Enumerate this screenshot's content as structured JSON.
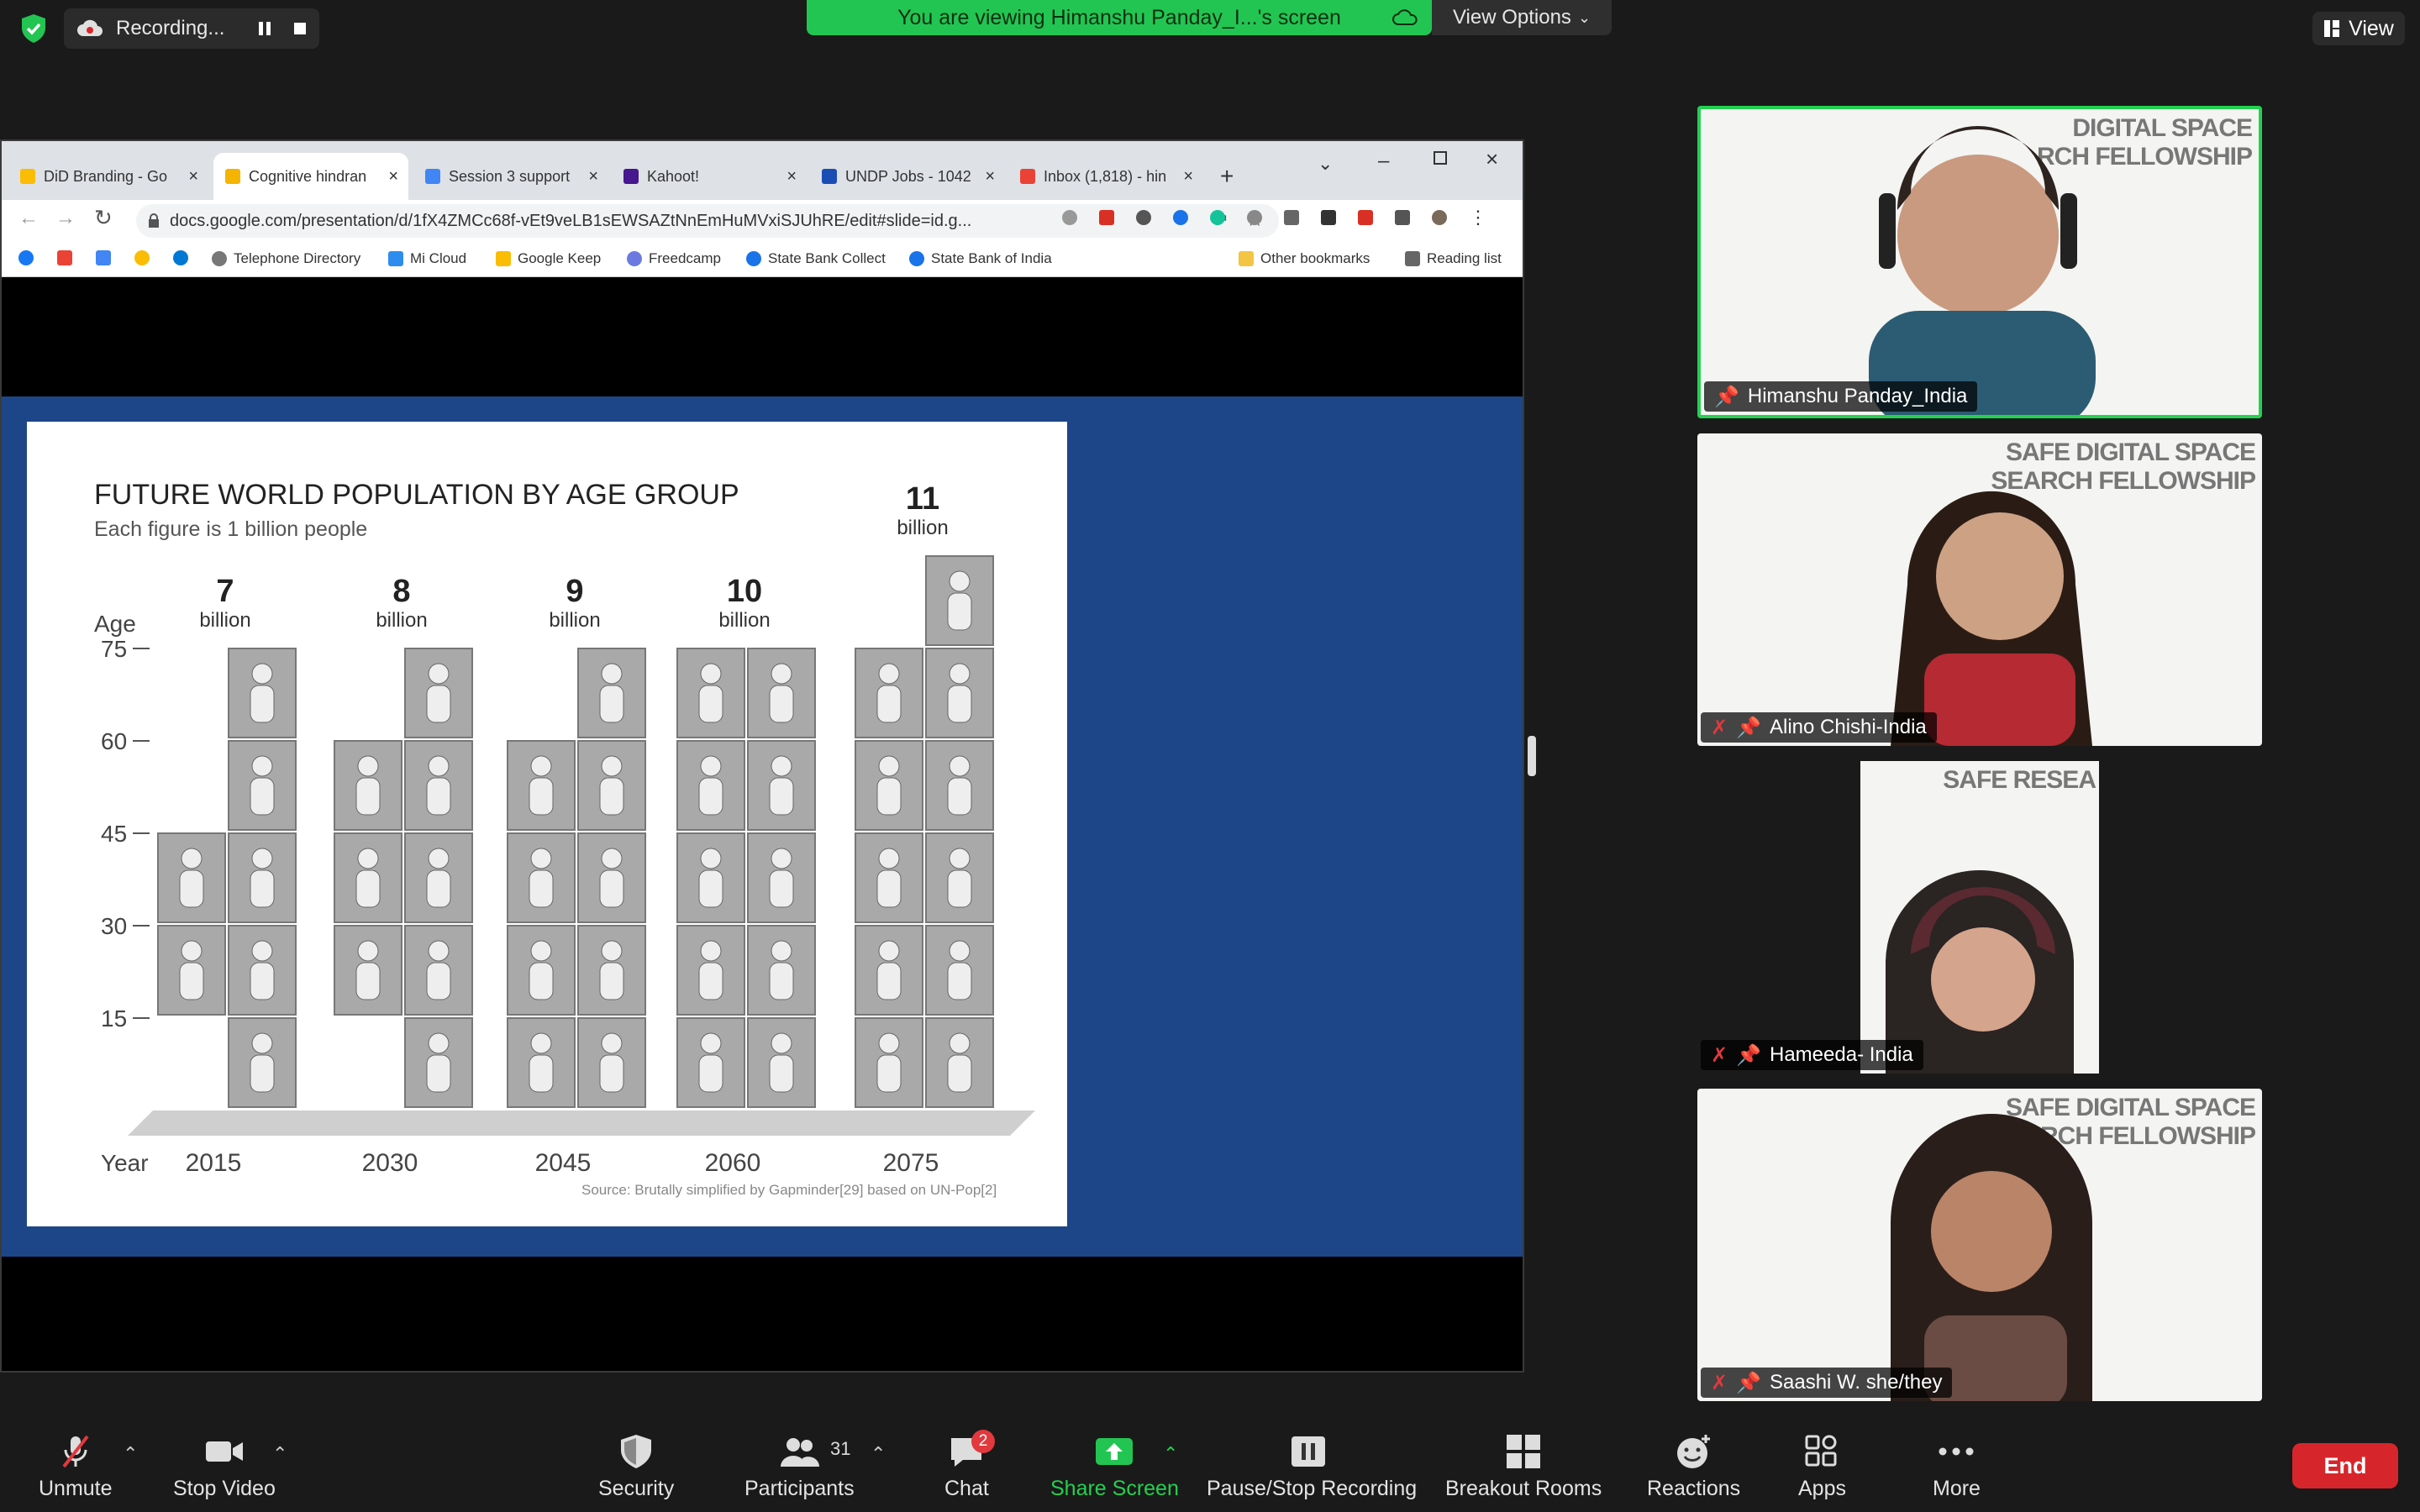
{
  "recording": {
    "label": "Recording..."
  },
  "banner": {
    "viewing": "You are viewing Himanshu Panday_I...'s screen",
    "view_options": "View Options",
    "view": "View"
  },
  "browser": {
    "tabs": [
      {
        "label": "DiD Branding - Go",
        "color": "#fbbc04"
      },
      {
        "label": "Cognitive hindran",
        "color": "#f4b400"
      },
      {
        "label": "Session 3 support",
        "color": "#4285f4"
      },
      {
        "label": "Kahoot!",
        "color": "#46178f"
      },
      {
        "label": "UNDP Jobs - 1042",
        "color": "#1a4eb5"
      },
      {
        "label": "Inbox (1,818) - hin",
        "color": "#ea4335"
      }
    ],
    "url": "docs.google.com/presentation/d/1fX4ZMCc68f-vEt9veLB1sEWSAZtNnEmHuMVxiSJUhRE/edit#slide=id.g...",
    "bookmarks": [
      "Telephone Directory",
      "Mi Cloud",
      "Google Keep",
      "Freedcamp",
      "State Bank Collect",
      "State Bank of India"
    ],
    "other_bookmarks": "Other bookmarks",
    "reading_list": "Reading list"
  },
  "chart_data": {
    "type": "bar",
    "title": "FUTURE WORLD POPULATION BY AGE GROUP",
    "subtitle": "Each figure is 1 billion people",
    "xlabel": "Year",
    "ylabel": "Age",
    "categories": [
      "2015",
      "2030",
      "2045",
      "2060",
      "2075"
    ],
    "totals": [
      "7",
      "8",
      "9",
      "10",
      "11"
    ],
    "total_unit": "billion",
    "yticks": [
      "75",
      "60",
      "45",
      "30",
      "15"
    ],
    "series": [
      {
        "values": [
          1,
          1,
          2,
          2,
          2
        ]
      },
      {
        "values": [
          2,
          2,
          2,
          2,
          2
        ]
      },
      {
        "values": [
          2,
          2,
          2,
          2,
          2
        ]
      },
      {
        "values": [
          1,
          2,
          2,
          2,
          2
        ]
      },
      {
        "values": [
          1,
          1,
          1,
          2,
          2
        ]
      },
      {
        "values": [
          0,
          0,
          0,
          0,
          1
        ]
      }
    ],
    "source": "Source: Brutally simplified by Gapminder[29] based on UN-Pop[2]"
  },
  "participants": [
    {
      "name": "Himanshu Panday_India",
      "muted": false,
      "banner": "DIGITAL SPACE\nRCH FELLOWSHIP"
    },
    {
      "name": "Alino Chishi-India",
      "muted": true,
      "banner": "SAFE DIGITAL SPACE\nSEARCH FELLOWSHIP"
    },
    {
      "name": "Hameeda- India",
      "muted": true,
      "banner": "SAFE\nRESEA"
    },
    {
      "name": "Saashi W. she/they",
      "muted": true,
      "banner": "SAFE DIGITAL SPACE\nESEARCH FELLOWSHIP"
    }
  ],
  "toolbar": {
    "unmute": "Unmute",
    "stop_video": "Stop Video",
    "security": "Security",
    "participants": "Participants",
    "participants_count": "31",
    "chat": "Chat",
    "chat_badge": "2",
    "share_screen": "Share Screen",
    "pause_stop_recording": "Pause/Stop Recording",
    "breakout_rooms": "Breakout Rooms",
    "reactions": "Reactions",
    "apps": "Apps",
    "more": "More",
    "end": "End"
  }
}
